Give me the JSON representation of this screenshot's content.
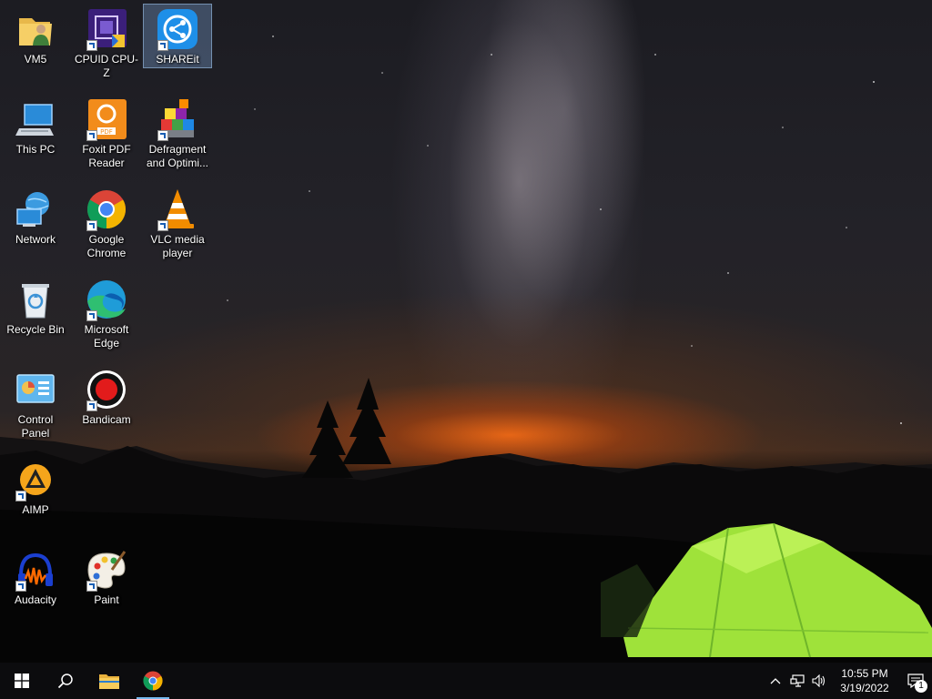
{
  "desktop": {
    "icons": [
      {
        "label": "VM5"
      },
      {
        "label": "CPUID CPU-Z"
      },
      {
        "label": "SHAREit"
      },
      {
        "label": "This PC"
      },
      {
        "label": "Foxit PDF Reader"
      },
      {
        "label": "Defragment and Optimi..."
      },
      {
        "label": "Network"
      },
      {
        "label": "Google Chrome"
      },
      {
        "label": "VLC media player"
      },
      {
        "label": "Recycle Bin"
      },
      {
        "label": "Microsoft Edge"
      },
      {
        "label": "Control Panel"
      },
      {
        "label": "Bandicam"
      },
      {
        "label": "AIMP"
      },
      {
        "label": "Audacity"
      },
      {
        "label": "Paint"
      }
    ],
    "selected": "SHAREit"
  },
  "taskbar": {
    "pinned": [
      "start-icon",
      "search-icon",
      "file-explorer-icon",
      "chrome-icon"
    ],
    "tray": {
      "time": "10:55 PM",
      "date": "3/19/2022",
      "notification_count": "1"
    }
  },
  "colors": {
    "taskbar_bg": "#0c0c0e",
    "active_indicator": "#76b9ed",
    "selection": "#82aadc"
  }
}
